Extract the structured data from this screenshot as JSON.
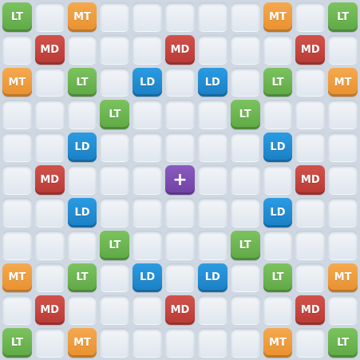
{
  "board": {
    "size": 11,
    "colors": {
      "LT": "#6ab54f",
      "MT": "#ef9d3c",
      "MD": "#c4443f",
      "LD": "#2189d2",
      "CENTER": "#7a4bb0",
      "EMPTY": "#e8edf3"
    },
    "labels": {
      "LT": "LT",
      "MT": "MT",
      "MD": "MD",
      "LD": "LD",
      "CENTER": "+"
    },
    "grid": [
      [
        "LT",
        "",
        "MT",
        "",
        "",
        "",
        "",
        "",
        "MT",
        "",
        "LT"
      ],
      [
        "",
        "MD",
        "",
        "",
        "",
        "MD",
        "",
        "",
        "",
        "MD",
        ""
      ],
      [
        "MT",
        "",
        "LT",
        "",
        "LD",
        "",
        "LD",
        "",
        "LT",
        "",
        "MT"
      ],
      [
        "",
        "",
        "",
        "LT",
        "",
        "",
        "",
        "LT",
        "",
        "",
        ""
      ],
      [
        "",
        "",
        "LD",
        "",
        "",
        "",
        "",
        "",
        "LD",
        "",
        ""
      ],
      [
        "",
        "MD",
        "",
        "",
        "",
        "CENTER",
        "",
        "",
        "",
        "MD",
        ""
      ],
      [
        "",
        "",
        "LD",
        "",
        "",
        "",
        "",
        "",
        "LD",
        "",
        ""
      ],
      [
        "",
        "",
        "",
        "LT",
        "",
        "",
        "",
        "LT",
        "",
        "",
        ""
      ],
      [
        "MT",
        "",
        "LT",
        "",
        "LD",
        "",
        "LD",
        "",
        "LT",
        "",
        "MT"
      ],
      [
        "",
        "MD",
        "",
        "",
        "",
        "MD",
        "",
        "",
        "",
        "MD",
        ""
      ],
      [
        "LT",
        "",
        "MT",
        "",
        "",
        "",
        "",
        "",
        "MT",
        "",
        "LT"
      ]
    ]
  }
}
